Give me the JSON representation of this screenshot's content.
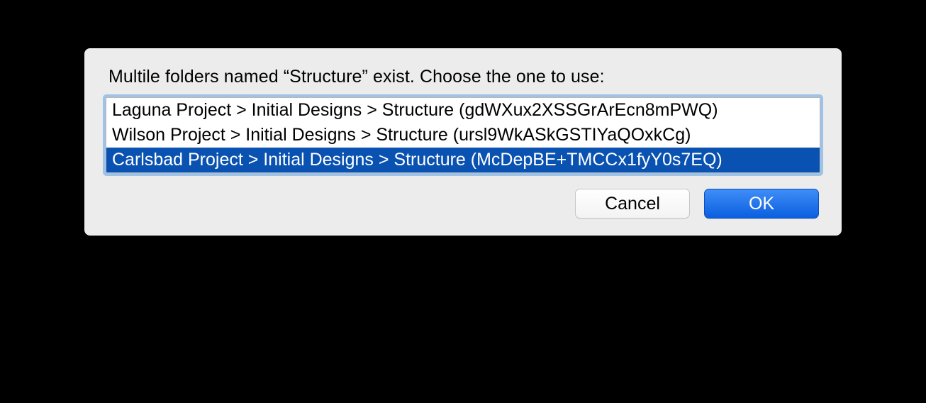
{
  "dialog": {
    "prompt": "Multile folders named “Structure” exist. Choose the one to use:",
    "items": [
      {
        "label": "Laguna Project > Initial Designs > Structure (gdWXux2XSSGrArEcn8mPWQ)",
        "selected": false
      },
      {
        "label": "Wilson Project > Initial Designs > Structure (ursl9WkASkGSTIYaQOxkCg)",
        "selected": false
      },
      {
        "label": "Carlsbad Project > Initial Designs > Structure (McDepBE+TMCCx1fyY0s7EQ)",
        "selected": true
      }
    ],
    "buttons": {
      "cancel": "Cancel",
      "ok": "OK"
    }
  }
}
